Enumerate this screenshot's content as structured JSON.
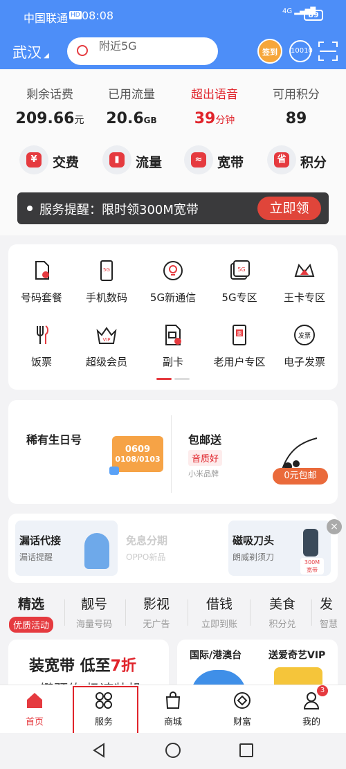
{
  "status": {
    "carrier": "中国联通",
    "hd": "HD",
    "time": "08:08",
    "signal": "4G",
    "battery": "89"
  },
  "header": {
    "city": "武汉",
    "search_placeholder": "附近5G",
    "checkin": "签到"
  },
  "stats": [
    {
      "label": "剩余话费",
      "value": "209.66",
      "unit": "元"
    },
    {
      "label": "已用流量",
      "value": "20.6",
      "unit": "GB"
    },
    {
      "label": "超出语音",
      "value": "39",
      "unit": "分钟"
    },
    {
      "label": "可用积分",
      "value": "89",
      "unit": ""
    }
  ],
  "quick": [
    {
      "label": "交费",
      "glyph": "¥"
    },
    {
      "label": "流量",
      "glyph": "▮"
    },
    {
      "label": "宽带",
      "glyph": "≈"
    },
    {
      "label": "积分",
      "glyph": "省"
    }
  ],
  "notice": {
    "text": "服务提醒：限时领300M宽带",
    "button": "立即领"
  },
  "grid": [
    {
      "label": "号码套餐",
      "icon": "sim-card-icon"
    },
    {
      "label": "手机数码",
      "icon": "phone-icon"
    },
    {
      "label": "5G新通信",
      "icon": "bulb-icon"
    },
    {
      "label": "5G专区",
      "icon": "5g-icon"
    },
    {
      "label": "王卡专区",
      "icon": "crown-icon"
    },
    {
      "label": "饭票",
      "icon": "fork-icon"
    },
    {
      "label": "超级会员",
      "icon": "vip-icon"
    },
    {
      "label": "副卡",
      "icon": "sub-card-icon"
    },
    {
      "label": "老用户专区",
      "icon": "gift-phone-icon"
    },
    {
      "label": "电子发票",
      "icon": "invoice-icon"
    }
  ],
  "icon_text": {
    "phone": "5G",
    "fiveg": "5G",
    "vip": "VIP",
    "invoice": "发票",
    "gift": "惠"
  },
  "promo": {
    "left_title": "稀有生日号",
    "badge_top": "0609",
    "badge_bottom": "0108/0103",
    "right_title": "包邮送",
    "right_tag": "音质好",
    "right_sub": "小米品牌",
    "right_button": "0元包邮"
  },
  "promo2": [
    {
      "title": "漏话代接",
      "sub": "漏话提醒"
    },
    {
      "title": "免息分期",
      "sub": "OPPO新品"
    },
    {
      "title": "磁吸刀头",
      "sub": "朗威剃须刀"
    }
  ],
  "promo2_badge": {
    "line1": "300M",
    "line2": "宽带"
  },
  "tabs": [
    {
      "title": "精选",
      "sub": "优质活动"
    },
    {
      "title": "靓号",
      "sub": "海量号码"
    },
    {
      "title": "影视",
      "sub": "无广告"
    },
    {
      "title": "借钱",
      "sub": "立即到账"
    },
    {
      "title": "美食",
      "sub": "积分兑"
    },
    {
      "title": "发",
      "sub": "智慧"
    }
  ],
  "feed": {
    "left_title_a": "装宽带 低至",
    "left_title_b": "7折",
    "left_sub": "键预约 极速装机",
    "right_a": "国际/港澳台",
    "right_b": "送爱奇艺VIP"
  },
  "nav": [
    {
      "label": "首页",
      "active": true
    },
    {
      "label": "服务",
      "active": false
    },
    {
      "label": "商城",
      "active": false
    },
    {
      "label": "财富",
      "active": false
    },
    {
      "label": "我的",
      "active": false
    }
  ],
  "nav_badge": "3",
  "colors": {
    "primary": "#4d8ef8",
    "accent": "#e53a3f",
    "dark_banner": "#3a3a3c",
    "highlight_box": "#e0242b"
  }
}
